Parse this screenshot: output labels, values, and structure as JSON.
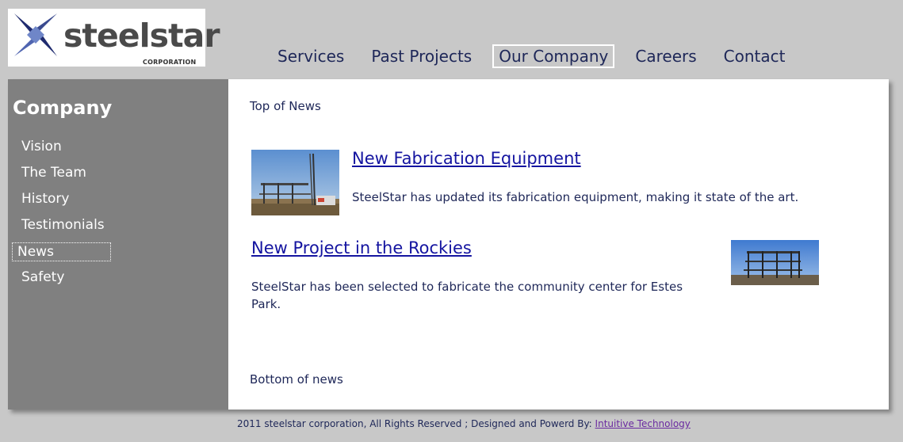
{
  "logo": {
    "word": "steelstar",
    "subtitle": "CORPORATION"
  },
  "nav": {
    "items": [
      {
        "label": "Services"
      },
      {
        "label": "Past Projects"
      },
      {
        "label": "Our Company",
        "active": true
      },
      {
        "label": "Careers"
      },
      {
        "label": "Contact"
      }
    ]
  },
  "sidebar": {
    "title": "Company",
    "items": [
      {
        "label": "Vision"
      },
      {
        "label": "The Team"
      },
      {
        "label": "History"
      },
      {
        "label": "Testimonials"
      },
      {
        "label": "News",
        "active": true
      },
      {
        "label": "Safety"
      }
    ]
  },
  "content": {
    "top_label": "Top of News",
    "bottom_label": "Bottom of news",
    "news": [
      {
        "headline": "New Fabrication Equipment",
        "body": "SteelStar has updated its fabrication equipment, making it state of the art."
      },
      {
        "headline": "New Project in the Rockies",
        "body": "SteelStar has been selected to fabricate the community center for Estes Park."
      }
    ]
  },
  "footer": {
    "text": "2011 steelstar corporation, All Rights Reserved ;   Designed and Powerd By: ",
    "link_label": "Intuitive Technology"
  },
  "colors": {
    "page_background": "#c8c8c8",
    "sidebar_background": "#808080",
    "nav_text": "#1e2758",
    "headline_link": "#1414a0",
    "footer_link": "#6a2aa0"
  }
}
